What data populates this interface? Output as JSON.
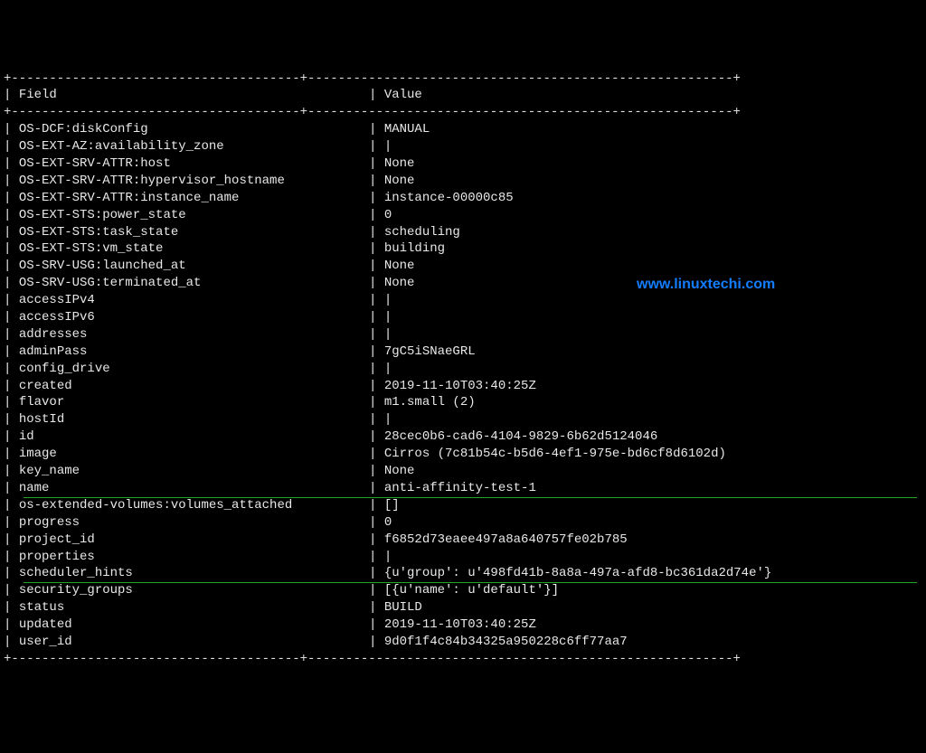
{
  "header": {
    "field": "Field",
    "value": "Value"
  },
  "watermark": "www.linuxtechi.com",
  "rows": [
    {
      "f": "OS-DCF:diskConfig",
      "v": "MANUAL"
    },
    {
      "f": "OS-EXT-AZ:availability_zone",
      "v": ""
    },
    {
      "f": "OS-EXT-SRV-ATTR:host",
      "v": "None"
    },
    {
      "f": "OS-EXT-SRV-ATTR:hypervisor_hostname",
      "v": "None"
    },
    {
      "f": "OS-EXT-SRV-ATTR:instance_name",
      "v": "instance-00000c85"
    },
    {
      "f": "OS-EXT-STS:power_state",
      "v": "0"
    },
    {
      "f": "OS-EXT-STS:task_state",
      "v": "scheduling"
    },
    {
      "f": "OS-EXT-STS:vm_state",
      "v": "building"
    },
    {
      "f": "OS-SRV-USG:launched_at",
      "v": "None"
    },
    {
      "f": "OS-SRV-USG:terminated_at",
      "v": "None"
    },
    {
      "f": "accessIPv4",
      "v": ""
    },
    {
      "f": "accessIPv6",
      "v": ""
    },
    {
      "f": "addresses",
      "v": ""
    },
    {
      "f": "adminPass",
      "v": "7gC5iSNaeGRL"
    },
    {
      "f": "config_drive",
      "v": ""
    },
    {
      "f": "created",
      "v": "2019-11-10T03:40:25Z"
    },
    {
      "f": "flavor",
      "v": "m1.small (2)"
    },
    {
      "f": "hostId",
      "v": ""
    },
    {
      "f": "id",
      "v": "28cec0b6-cad6-4104-9829-6b62d5124046"
    },
    {
      "f": "image",
      "v": "Cirros (7c81b54c-b5d6-4ef1-975e-bd6cf8d6102d)"
    },
    {
      "f": "key_name",
      "v": "None"
    },
    {
      "f": "name",
      "v": "anti-affinity-test-1",
      "highlight": true
    },
    {
      "f": "os-extended-volumes:volumes_attached",
      "v": "[]"
    },
    {
      "f": "progress",
      "v": "0"
    },
    {
      "f": "project_id",
      "v": "f6852d73eaee497a8a640757fe02b785"
    },
    {
      "f": "properties",
      "v": ""
    },
    {
      "f": "scheduler_hints",
      "v": "{u'group': u'498fd41b-8a8a-497a-afd8-bc361da2d74e'}",
      "highlight": true
    },
    {
      "f": "security_groups",
      "v": "[{u'name': u'default'}]"
    },
    {
      "f": "status",
      "v": "BUILD"
    },
    {
      "f": "updated",
      "v": "2019-11-10T03:40:25Z"
    },
    {
      "f": "user_id",
      "v": "9d0f1f4c84b34325a950228c6ff77aa7"
    }
  ]
}
